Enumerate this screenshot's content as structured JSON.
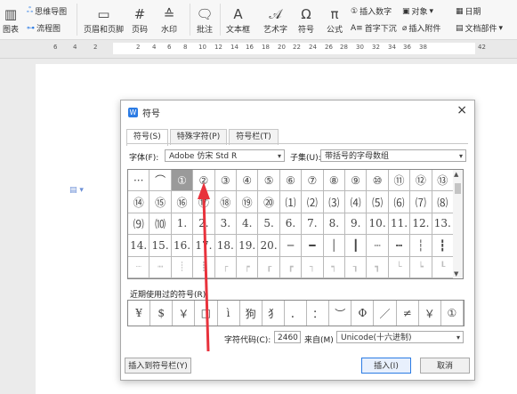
{
  "ribbon": {
    "chart_label": "图表",
    "mindmap_label": "思维导图",
    "flowchart_label": "流程图",
    "header_footer_label": "页眉和页脚",
    "page_number_label": "页码",
    "watermark_label": "水印",
    "comment_label": "批注",
    "textbox_label": "文本框",
    "wordart_label": "艺术字",
    "symbol_label": "符号",
    "formula_label": "公式",
    "insert_number_label": "插入数字",
    "object_label": "对象",
    "date_label": "日期",
    "dropcap_label": "首字下沉",
    "attachment_label": "插入附件",
    "docparts_label": "文档部件"
  },
  "ruler": {
    "numbers": [
      "6",
      "4",
      "2",
      "2",
      "4",
      "6",
      "8",
      "10",
      "12",
      "14",
      "16",
      "18",
      "20",
      "22",
      "24",
      "26",
      "28",
      "30",
      "32",
      "34",
      "36",
      "38",
      "42"
    ]
  },
  "dialog": {
    "title": "符号",
    "close": "×",
    "tabs": [
      "符号(S)",
      "特殊字符(P)",
      "符号栏(T)"
    ],
    "font_label": "字体(F):",
    "font_value": "Adobe 仿宋 Std R",
    "subset_label": "子集(U):",
    "subset_value": "带括号的字母数组",
    "symbols": [
      "···",
      "⌒",
      "①",
      "②",
      "③",
      "④",
      "⑤",
      "⑥",
      "⑦",
      "⑧",
      "⑨",
      "⑩",
      "⑪",
      "⑫",
      "⑬",
      "⑭",
      "⑮",
      "⑯",
      "⑰",
      "⑱",
      "⑲",
      "⑳",
      "⑴",
      "⑵",
      "⑶",
      "⑷",
      "⑸",
      "⑹",
      "⑺",
      "⑻",
      "⑼",
      "⑽",
      "1.",
      "2.",
      "3.",
      "4.",
      "5.",
      "6.",
      "7.",
      "8.",
      "9.",
      "10.",
      "11.",
      "12.",
      "13.",
      "14.",
      "15.",
      "16.",
      "17.",
      "18.",
      "19.",
      "20.",
      "─",
      "━",
      "│",
      "┃",
      "┄",
      "┅",
      "┆",
      "┇",
      "┈",
      "┉",
      "┊",
      "┋",
      "┌",
      "┍",
      "┎",
      "┏",
      "┐",
      "┑",
      "┒",
      "┓",
      "└",
      "┕",
      "┖"
    ],
    "recent_label": "近期使用过的符号(R):",
    "recent_symbols": [
      "¥",
      "$",
      "￥",
      "□",
      "ì",
      "狗",
      "犭",
      "．",
      "：",
      "︶",
      "Φ",
      "／",
      "≠",
      "￥",
      "①"
    ],
    "code_label": "字符代码(C):",
    "code_value": "2460",
    "from_label": "来自(M)",
    "from_value": "Unicode(十六进制)",
    "insert_to_bar": "插入到符号栏(Y)",
    "insert": "插入(I)",
    "cancel": "取消",
    "selected_index": 2
  },
  "colors": {
    "accent": "#2b7be4",
    "arrow": "#e8323c"
  }
}
